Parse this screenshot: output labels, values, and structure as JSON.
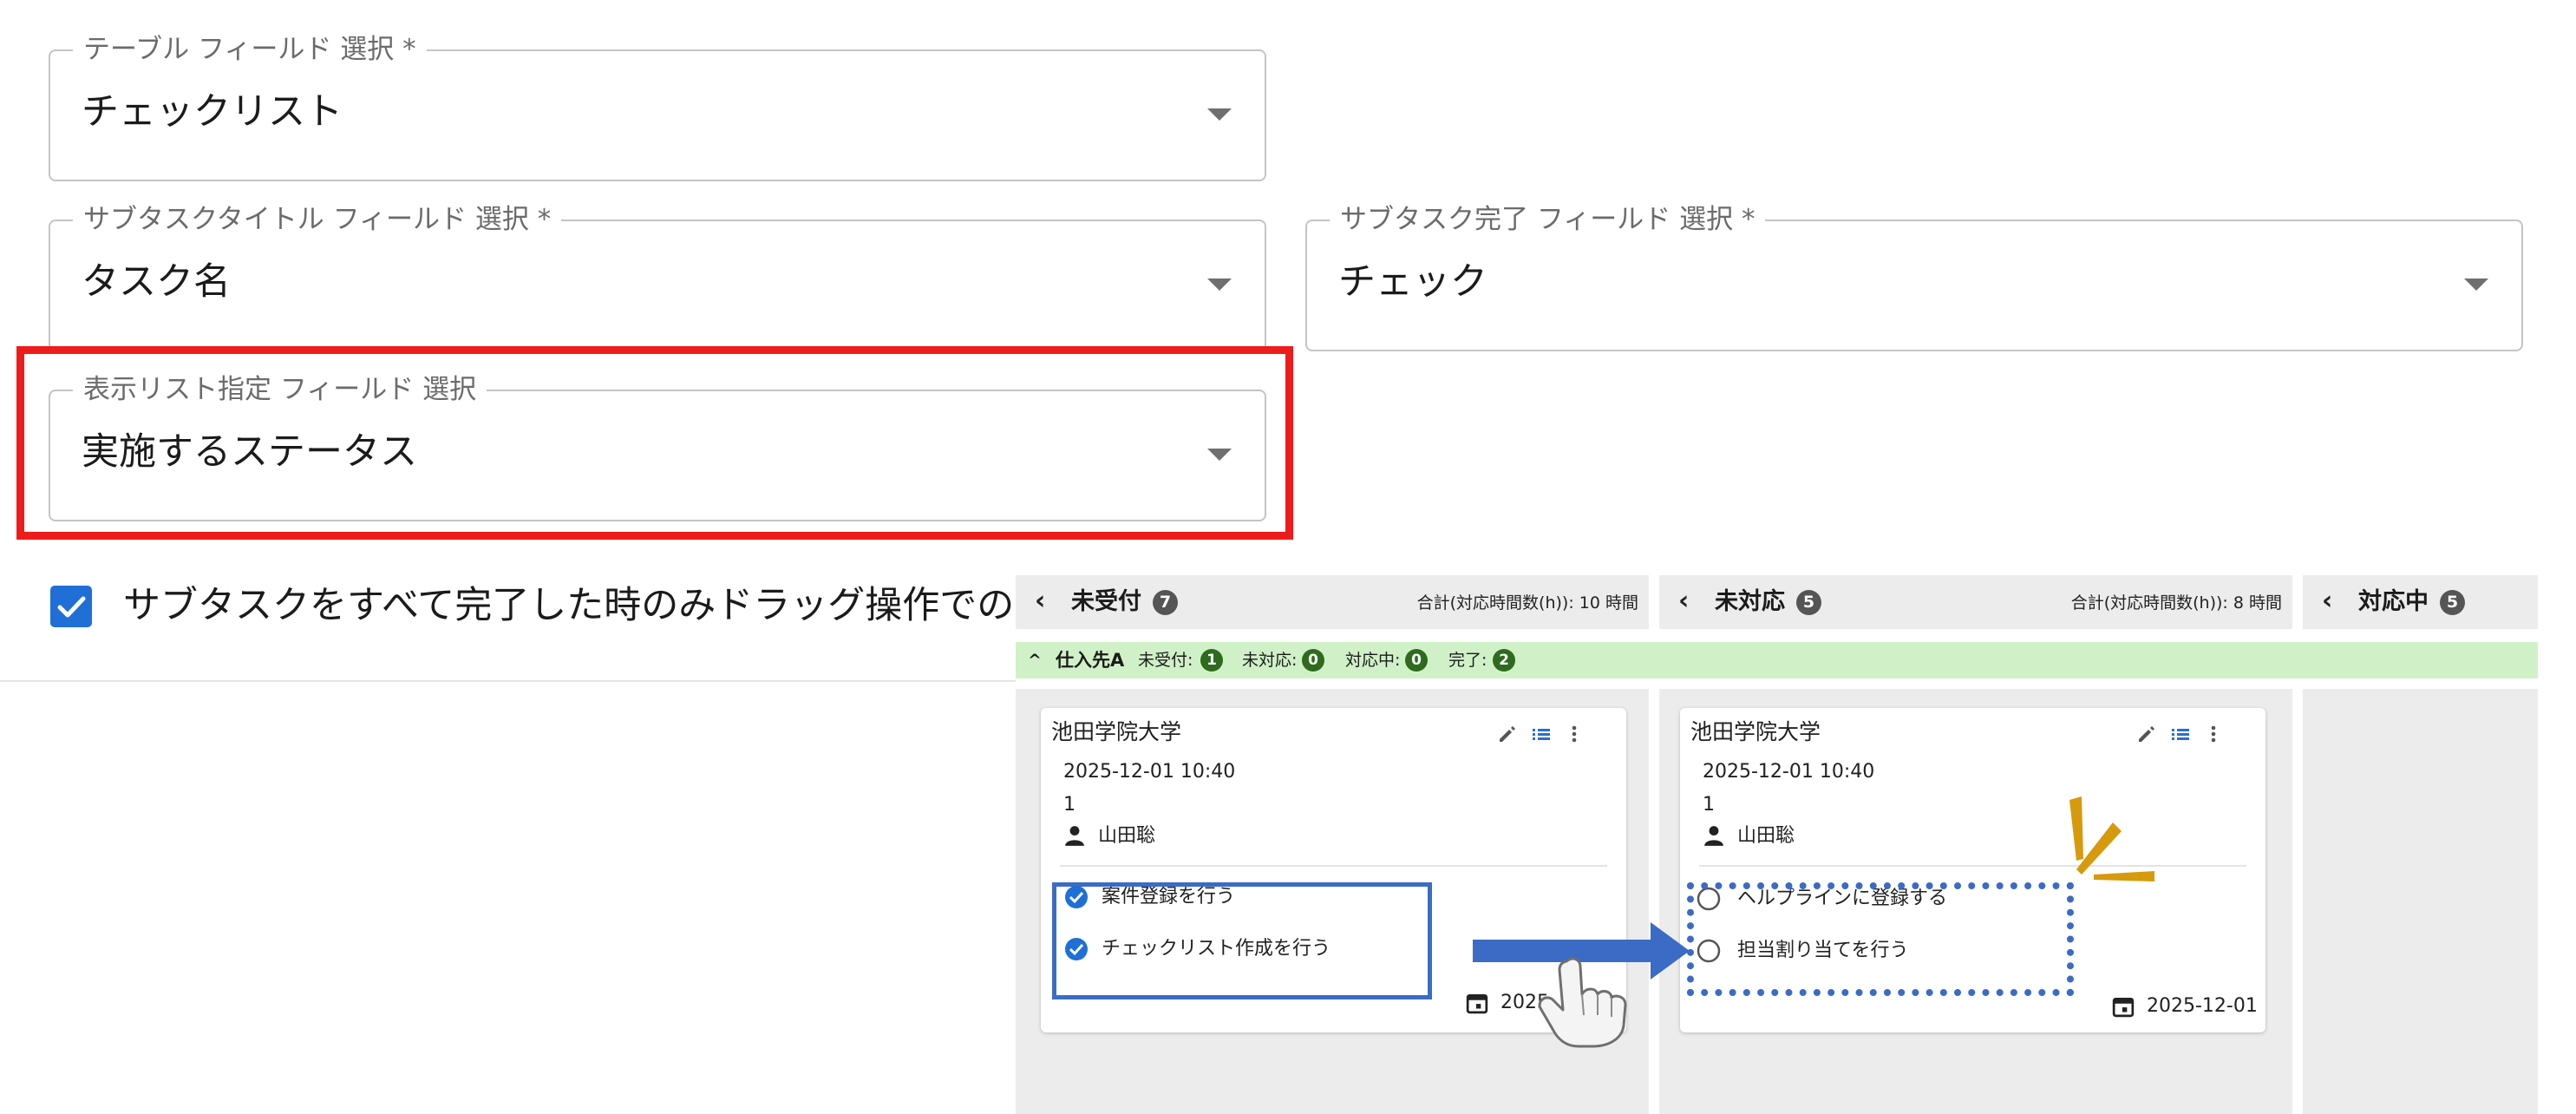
{
  "settings": {
    "table_field": {
      "label": "テーブル フィールド 選択 *",
      "value": "チェックリスト"
    },
    "subtask_title_field": {
      "label": "サブタスクタイトル フィールド 選択 *",
      "value": "タスク名"
    },
    "subtask_done_field": {
      "label": "サブタスク完了 フィールド 選択 *",
      "value": "チェック"
    },
    "display_list_field": {
      "label": "表示リスト指定 フィールド 選択",
      "value": "実施するステータス"
    },
    "checkbox": {
      "checked": true,
      "label": "サブタスクをすべて完了した時のみドラッグ操作での"
    }
  },
  "board": {
    "columns": [
      {
        "name": "未受付",
        "count": "7",
        "total": "合計(対応時間数(h)): 10 時間"
      },
      {
        "name": "未対応",
        "count": "5",
        "total": "合計(対応時間数(h)): 8 時間"
      },
      {
        "name": "対応中",
        "count": "5",
        "total": ""
      }
    ],
    "group": {
      "name": "仕入先A",
      "stats": [
        {
          "label": "未受付:",
          "count": "1"
        },
        {
          "label": "未対応:",
          "count": "0"
        },
        {
          "label": "対応中:",
          "count": "0"
        },
        {
          "label": "完了:",
          "count": "2"
        }
      ]
    },
    "cards": [
      {
        "title": "池田学院大学",
        "datetime": "2025-12-01 10:40",
        "number": "1",
        "assignee": "山田聡",
        "subtasks": [
          {
            "label": "案件登録を行う",
            "done": true
          },
          {
            "label": "チェックリスト作成を行う",
            "done": true
          }
        ],
        "due": "2025-"
      },
      {
        "title": "池田学院大学",
        "datetime": "2025-12-01 10:40",
        "number": "1",
        "assignee": "山田聡",
        "subtasks": [
          {
            "label": "ヘルプラインに登録する",
            "done": false
          },
          {
            "label": "担当割り当てを行う",
            "done": false
          }
        ],
        "due": "2025-12-01"
      }
    ]
  },
  "colors": {
    "accent": "#1f6fd6",
    "highlight": "#ee1b1b",
    "group_bg": "#d0f1c7",
    "annotation": "#3b6bc5",
    "spark": "#d69a0c"
  }
}
